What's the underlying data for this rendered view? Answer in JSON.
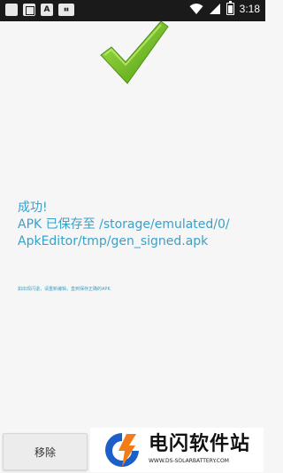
{
  "status_bar": {
    "time": "3:18",
    "icons": [
      "image-icon",
      "box-icon",
      "a-icon",
      "media-icon",
      "wifi-icon",
      "signal-icon",
      "battery-icon"
    ]
  },
  "colors": {
    "message": "#3aa0c8",
    "check_green": "#6bbf1e",
    "status_bar_bg": "#1a1a1a"
  },
  "message": {
    "line1": "成功!",
    "line2": "APK 已保存至 /storage/emulated/0/",
    "line3": "ApkEditor/tmp/gen_signed.apk"
  },
  "note": "如出现闪退，请重新编辑，直到保存正确的APK",
  "buttons": {
    "remove_label": "移除"
  },
  "watermark": {
    "title": "电闪软件站",
    "subtitle": "WWW.DS-SOLARBATTERY.COM"
  }
}
